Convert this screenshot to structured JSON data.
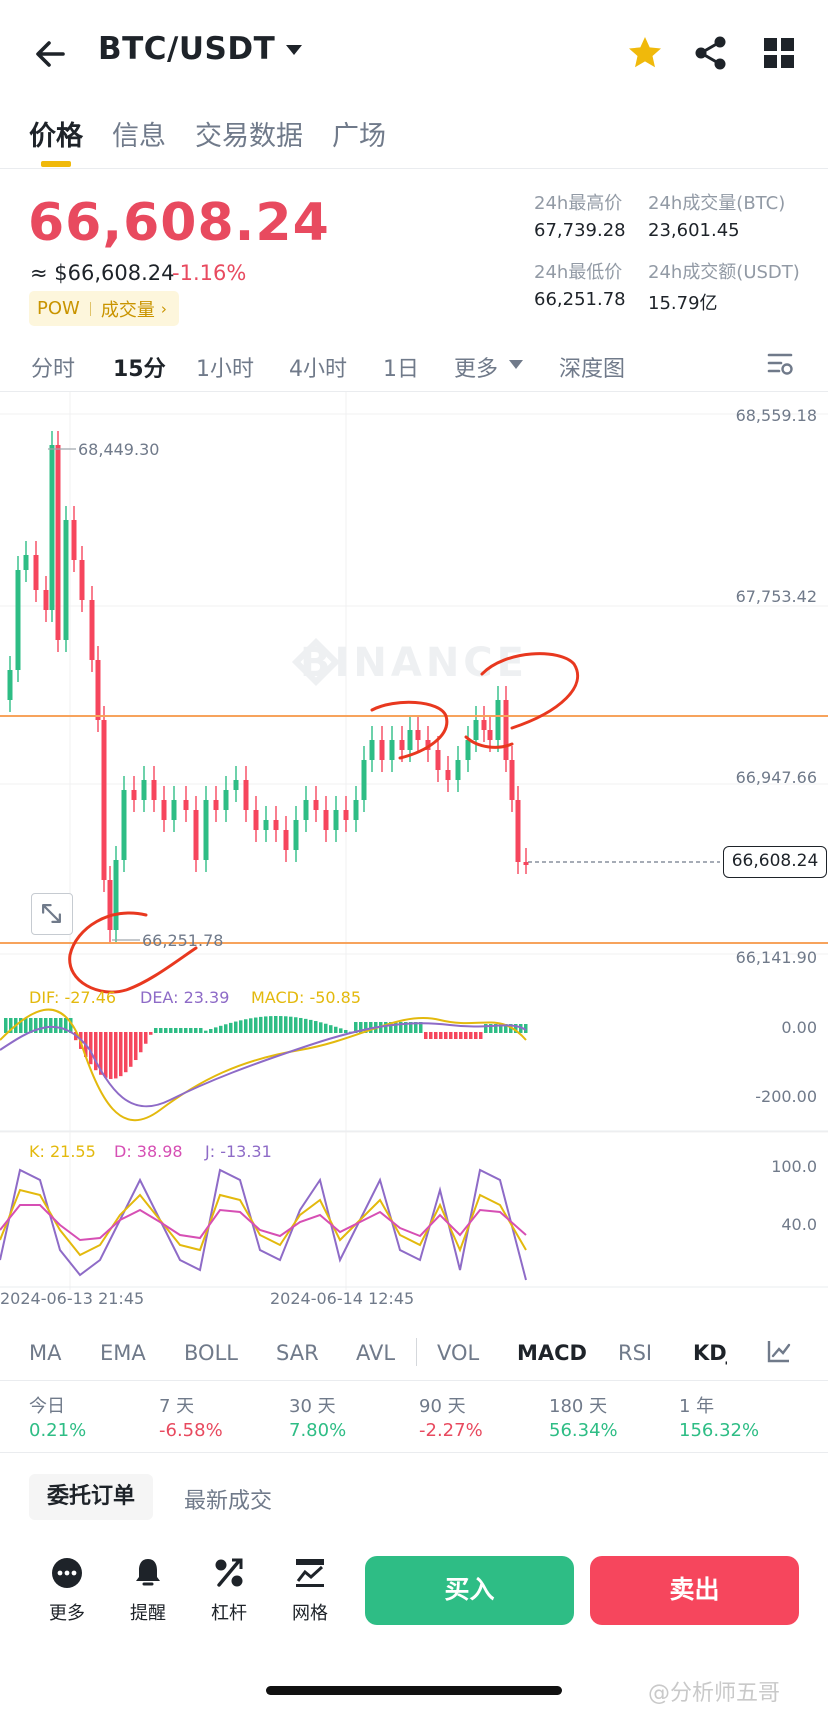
{
  "header": {
    "pair": "BTC/USDT",
    "icons": [
      "back-arrow-icon",
      "caret-down-icon",
      "star-icon",
      "share-icon",
      "grid-icon"
    ],
    "favorite_color": "#f0b90b"
  },
  "tabs": [
    "价格",
    "信息",
    "交易数据",
    "广场"
  ],
  "summary": {
    "last_price": "66,608.24",
    "usd_price": "≈ $66,608.24",
    "change": "-1.16%",
    "badge_left": "POW",
    "badge_right": "成交量",
    "high_label": "24h最高价",
    "high_value": "67,739.28",
    "vol_btc_label": "24h成交量(BTC)",
    "vol_btc_value": "23,601.45",
    "low_label": "24h最低价",
    "low_value": "66,251.78",
    "vol_usdt_label": "24h成交额(USDT)",
    "vol_usdt_value": "15.79亿"
  },
  "timeframes": [
    "分时",
    "15分",
    "1小时",
    "4小时",
    "1日",
    "更多",
    "深度图"
  ],
  "chart": {
    "watermark": "BINANCE",
    "y_axis": [
      "68,559.18",
      "67,753.42",
      "66,947.66",
      "66,141.90"
    ],
    "high_marker": "68,449.30",
    "low_marker": "66,251.78",
    "current_price": "66,608.24",
    "macd_labels": {
      "dif": "DIF: -27.46",
      "dea": "DEA: 23.39",
      "macd": "MACD: -50.85"
    },
    "macd_axis": [
      "0.00",
      "-200.00"
    ],
    "kdj_labels": {
      "k": "K: 21.55",
      "d": "D: 38.98",
      "j": "J: -13.31"
    },
    "kdj_axis": [
      "100.0",
      "40.0"
    ],
    "x_axis": [
      "2024-06-13 21:45",
      "2024-06-14 12:45"
    ],
    "colors": {
      "up": "#2ebd85",
      "down": "#f6465d",
      "line": "#f7a35c",
      "annotation": "#e8381f",
      "dif": "#e3b90d",
      "dea": "#8e6bc7",
      "k": "#e3b90d",
      "d": "#d64fb4",
      "j": "#8e6bc7"
    }
  },
  "indicators": [
    "MA",
    "EMA",
    "BOLL",
    "SAR",
    "AVL",
    "VOL",
    "MACD",
    "RSI",
    "KDJ"
  ],
  "performance": [
    {
      "label": "今日",
      "value": "0.21%"
    },
    {
      "label": "7 天",
      "value": "-6.58%"
    },
    {
      "label": "30 天",
      "value": "7.80%"
    },
    {
      "label": "90 天",
      "value": "-2.27%"
    },
    {
      "label": "180 天",
      "value": "56.34%"
    },
    {
      "label": "1 年",
      "value": "156.32%"
    }
  ],
  "order_tabs": [
    "委托订单",
    "最新成交"
  ],
  "bottom_bar": {
    "more": "更多",
    "alert": "提醒",
    "leverage": "杠杆",
    "grid": "网格",
    "buy": "买入",
    "sell": "卖出"
  },
  "watermark_text": "@分析师五哥"
}
